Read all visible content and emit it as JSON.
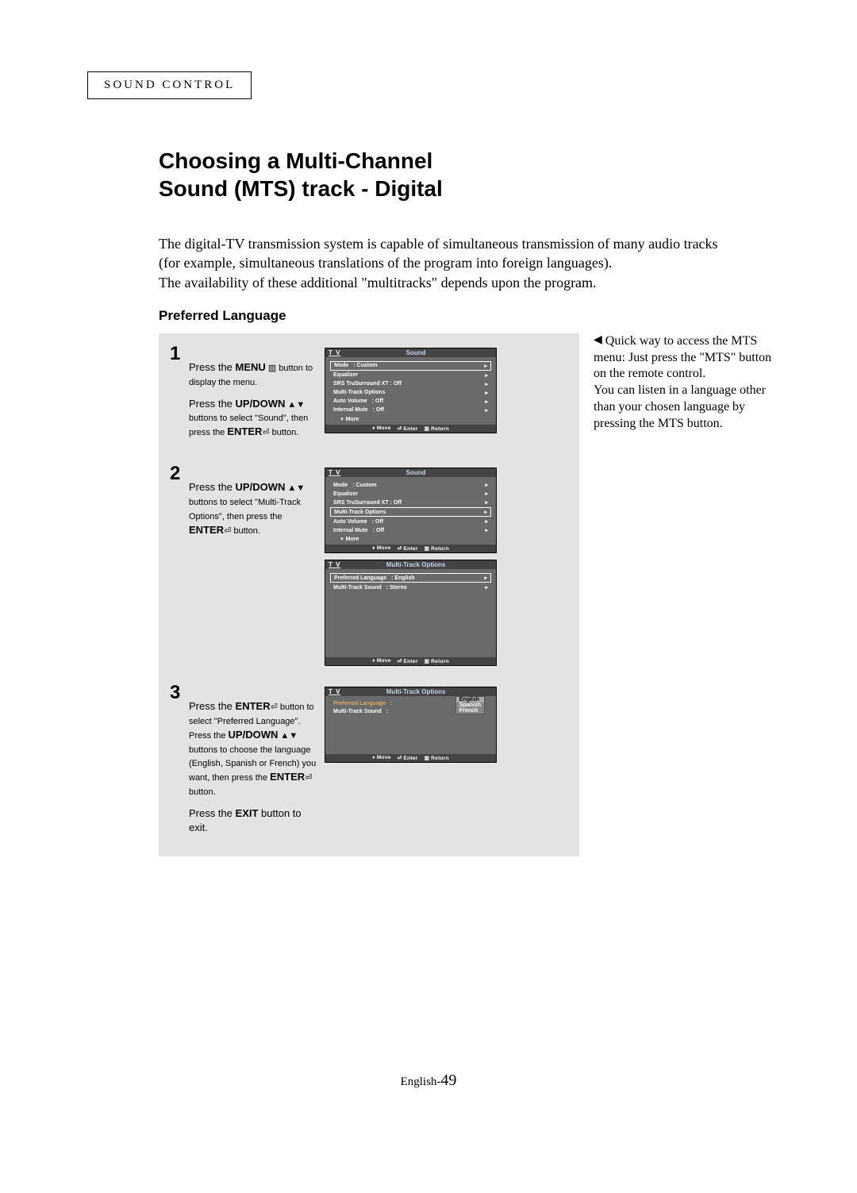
{
  "header": {
    "section": "SOUND CONTROL"
  },
  "heading": {
    "line1": "Choosing a Multi-Channel",
    "line2": "Sound (MTS) track - Digital"
  },
  "intro": {
    "p1": "The digital-TV transmission system is capable of simultaneous transmission of many audio tracks (for example, simultaneous translations of the program into foreign languages).",
    "p2": "The availability of these additional \"multitracks\" depends upon the program."
  },
  "subheading": "Preferred Language",
  "steps": {
    "s1": {
      "num": "1",
      "p1a": "Press the ",
      "p1b": "MENU",
      "p1c": " ▥ button to display the menu.",
      "p2a": "Press the ",
      "p2b": "UP/DOWN",
      "p2c": " ▲▼ buttons to select \"Sound\", then press the ",
      "p2d": "ENTER",
      "p2e": "⏎ button."
    },
    "s2": {
      "num": "2",
      "p1a": "Press the ",
      "p1b": "UP/DOWN",
      "p1c": " ▲▼ buttons to select \"Multi-Track Options\", then press the ",
      "p1d": "ENTER",
      "p1e": "⏎ button."
    },
    "s3": {
      "num": "3",
      "p1a": "Press the ",
      "p1b": "ENTER",
      "p1c": "⏎ button to select \"Preferred Language\". Press the ",
      "p1d": "UP/DOWN",
      "p1e": " ▲▼ buttons to choose the language (English, Spanish or French) you want, then press the ",
      "p1f": "ENTER",
      "p1g": "⏎ button.",
      "p2a": "Press the ",
      "p2b": "EXIT",
      "p2c": " button to exit."
    }
  },
  "tv_common": {
    "label": "T V",
    "move": "♦ Move",
    "enter": "⏎ Enter",
    "return": "▥ Return",
    "more": "More",
    "arrow": "▸"
  },
  "tv_sound": {
    "title": "Sound",
    "r1": {
      "l": "Mode",
      "v": ": Custom"
    },
    "r2": {
      "l": "Equalizer",
      "v": ""
    },
    "r3": {
      "l": "SRS TruSurround XT : Off",
      "v": ""
    },
    "r4": {
      "l": "Multi-Track Options",
      "v": ""
    },
    "r5": {
      "l": "Auto Volume",
      "v": ": Off"
    },
    "r6": {
      "l": "Internal Mute",
      "v": ": Off"
    }
  },
  "tv_mto": {
    "title": "Multi-Track Options",
    "r1": {
      "l": "Preferred Language",
      "v": ": English"
    },
    "r2": {
      "l": "Multi-Track Sound",
      "v": ": Stereo"
    }
  },
  "tv_lang": {
    "title": "Multi-Track Options",
    "r1": {
      "l": "Preferred Language",
      "v": ":"
    },
    "r2": {
      "l": "Multi-Track Sound",
      "v": ":"
    },
    "opt1": "English",
    "opt2": "Spanish",
    "opt3": "French"
  },
  "sidebar": {
    "arrow": "◀",
    "text": "Quick way to access the MTS menu: Just press the \"MTS\" button on the remote control.\nYou can listen in a language other than your chosen language by pressing the MTS button."
  },
  "footer": {
    "prefix": "English-",
    "page": "49"
  }
}
